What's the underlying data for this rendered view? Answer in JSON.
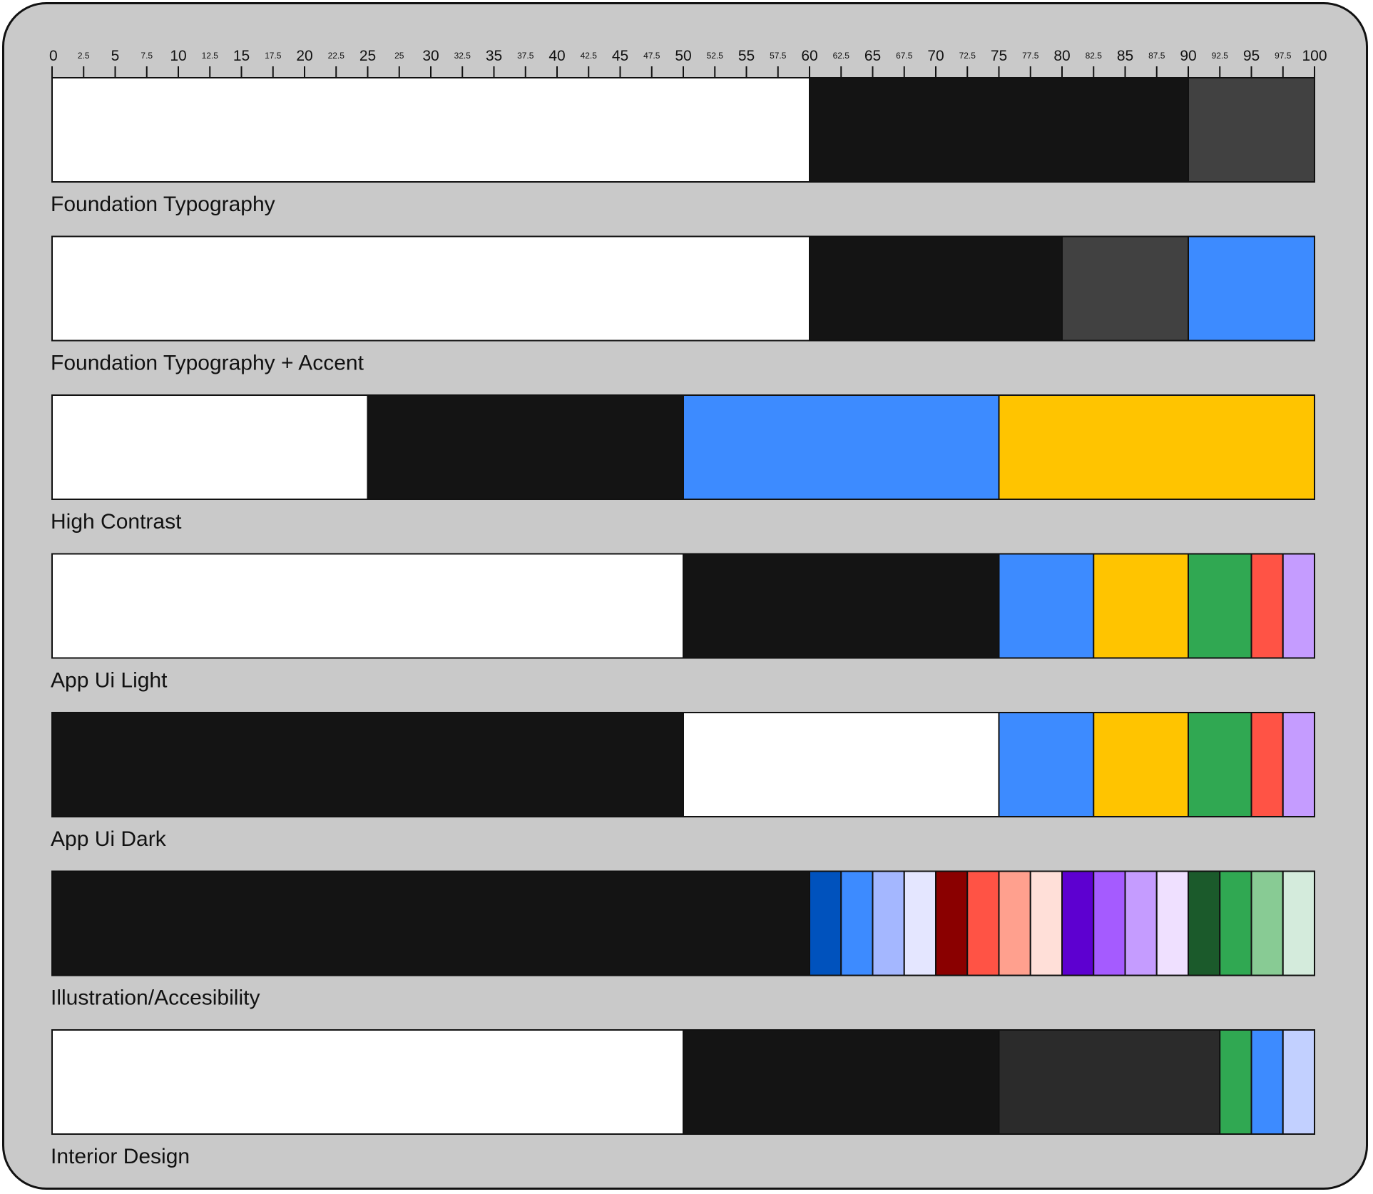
{
  "chart_data": {
    "type": "bar",
    "orientation": "horizontal-stacked",
    "title": "",
    "xlabel": "",
    "ylabel": "",
    "xlim": [
      0,
      100
    ],
    "grid": false,
    "legend": "none",
    "tick_labels": [
      "0",
      "2.5",
      "5",
      "7.5",
      "10",
      "12.5",
      "15",
      "17.5",
      "20",
      "22.5",
      "25",
      "25",
      "30",
      "32.5",
      "35",
      "37.5",
      "40",
      "42.5",
      "45",
      "47.5",
      "50",
      "52.5",
      "55",
      "57.5",
      "60",
      "62.5",
      "65",
      "67.5",
      "70",
      "72.5",
      "75",
      "77.5",
      "80",
      "82.5",
      "85",
      "87.5",
      "90",
      "92.5",
      "95",
      "97.5",
      "100"
    ],
    "rows": [
      {
        "label": "Foundation Typography",
        "segments": [
          {
            "value": 60,
            "color": "#ffffff"
          },
          {
            "value": 30,
            "color": "#141414"
          },
          {
            "value": 10,
            "color": "#414141"
          }
        ]
      },
      {
        "label": "Foundation Typography + Accent",
        "segments": [
          {
            "value": 60,
            "color": "#ffffff"
          },
          {
            "value": 20,
            "color": "#141414"
          },
          {
            "value": 10,
            "color": "#414141"
          },
          {
            "value": 10,
            "color": "#3d8bff"
          }
        ]
      },
      {
        "label": "High Contrast",
        "segments": [
          {
            "value": 25,
            "color": "#ffffff"
          },
          {
            "value": 25,
            "color": "#141414"
          },
          {
            "value": 25,
            "color": "#3d8bff"
          },
          {
            "value": 25,
            "color": "#ffc400"
          }
        ]
      },
      {
        "label": "App Ui Light",
        "segments": [
          {
            "value": 50,
            "color": "#ffffff"
          },
          {
            "value": 25,
            "color": "#141414"
          },
          {
            "value": 7.5,
            "color": "#3d8bff"
          },
          {
            "value": 7.5,
            "color": "#ffc400"
          },
          {
            "value": 5,
            "color": "#30a852"
          },
          {
            "value": 2.5,
            "color": "#ff5345"
          },
          {
            "value": 2.5,
            "color": "#c59cff"
          }
        ]
      },
      {
        "label": "App Ui Dark",
        "segments": [
          {
            "value": 50,
            "color": "#141414"
          },
          {
            "value": 25,
            "color": "#ffffff"
          },
          {
            "value": 7.5,
            "color": "#3d8bff"
          },
          {
            "value": 7.5,
            "color": "#ffc400"
          },
          {
            "value": 5,
            "color": "#30a852"
          },
          {
            "value": 2.5,
            "color": "#ff5345"
          },
          {
            "value": 2.5,
            "color": "#c59cff"
          }
        ]
      },
      {
        "label": "Illustration/Accesibility",
        "segments": [
          {
            "value": 60,
            "color": "#141414"
          },
          {
            "value": 2.5,
            "color": "#0052bd"
          },
          {
            "value": 2.5,
            "color": "#3d8bff"
          },
          {
            "value": 2.5,
            "color": "#a4b7ff"
          },
          {
            "value": 2.5,
            "color": "#e4e6ff"
          },
          {
            "value": 2.5,
            "color": "#8a0000"
          },
          {
            "value": 2.5,
            "color": "#ff5345"
          },
          {
            "value": 2.5,
            "color": "#ffa08e"
          },
          {
            "value": 2.5,
            "color": "#ffdfd8"
          },
          {
            "value": 2.5,
            "color": "#5d00d0"
          },
          {
            "value": 2.5,
            "color": "#a55bff"
          },
          {
            "value": 2.5,
            "color": "#c59cff"
          },
          {
            "value": 2.5,
            "color": "#efe0ff"
          },
          {
            "value": 2.5,
            "color": "#1b5a2b"
          },
          {
            "value": 2.5,
            "color": "#30a852"
          },
          {
            "value": 2.5,
            "color": "#88cb94"
          },
          {
            "value": 2.5,
            "color": "#d4ebdc"
          }
        ]
      },
      {
        "label": "Interior Design",
        "segments": [
          {
            "value": 50,
            "color": "#ffffff"
          },
          {
            "value": 25,
            "color": "#141414"
          },
          {
            "value": 17.5,
            "color": "#2b2b2b"
          },
          {
            "value": 2.5,
            "color": "#30a852"
          },
          {
            "value": 2.5,
            "color": "#3d8bff"
          },
          {
            "value": 2.5,
            "color": "#c2d0ff"
          }
        ]
      }
    ]
  }
}
